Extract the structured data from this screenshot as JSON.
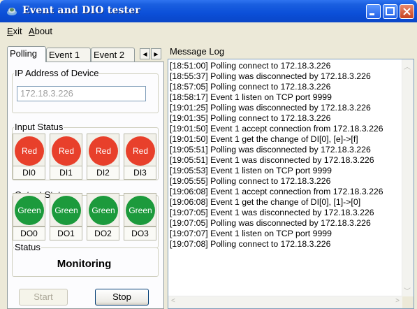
{
  "window": {
    "title": "Event and DIO tester"
  },
  "menu": {
    "exit_prefix": "E",
    "exit_rest": "xit",
    "about_prefix": "A",
    "about_rest": "bout"
  },
  "tabs": [
    "Polling",
    "Event 1",
    "Event 2"
  ],
  "ip_group": {
    "label": "IP Address of Device",
    "value": "172.18.3.226"
  },
  "input_status": {
    "label": "Input Status",
    "channels": [
      {
        "state": "Red",
        "name": "DI0"
      },
      {
        "state": "Red",
        "name": "DI1"
      },
      {
        "state": "Red",
        "name": "DI2"
      },
      {
        "state": "Red",
        "name": "DI3"
      }
    ]
  },
  "output_status": {
    "label": "Output Status",
    "channels": [
      {
        "state": "Green",
        "name": "DO0"
      },
      {
        "state": "Green",
        "name": "DO1"
      },
      {
        "state": "Green",
        "name": "DO2"
      },
      {
        "state": "Green",
        "name": "DO3"
      }
    ]
  },
  "status": {
    "label": "Status",
    "value": "Monitoring"
  },
  "buttons": {
    "start": "Start",
    "stop": "Stop"
  },
  "log": {
    "label": "Message Log",
    "lines": [
      "[18:51:00] Polling connect to 172.18.3.226",
      "[18:55:37] Polling was disconnected by 172.18.3.226",
      "[18:57:05] Polling connect to 172.18.3.226",
      "[18:58:17] Event 1 listen on TCP port 9999",
      "[19:01:25] Polling was disconnected by 172.18.3.226",
      "[19:01:35] Polling connect to 172.18.3.226",
      "[19:01:50] Event 1 accept connection from 172.18.3.226",
      "[19:01:50] Event 1 get the change of DI[0], [e]->[f]",
      "[19:05:51] Polling was disconnected by 172.18.3.226",
      "[19:05:51] Event 1 was disconnected by 172.18.3.226",
      "[19:05:53] Event 1 listen on TCP port 9999",
      "[19:05:55] Polling connect to 172.18.3.226",
      "[19:06:08] Event 1 accept connection from 172.18.3.226",
      "[19:06:08] Event 1 get the change of DI[0], [1]->[0]",
      "[19:07:05] Event 1 was disconnected by 172.18.3.226",
      "[19:07:05] Polling was disconnected by 172.18.3.226",
      "[19:07:07] Event 1 listen on TCP port 9999",
      "[19:07:08] Polling connect to 172.18.3.226"
    ]
  },
  "colors": {
    "red": "#e8402b",
    "green": "#1c9a3c",
    "titlebar": "#0b4fd8"
  }
}
